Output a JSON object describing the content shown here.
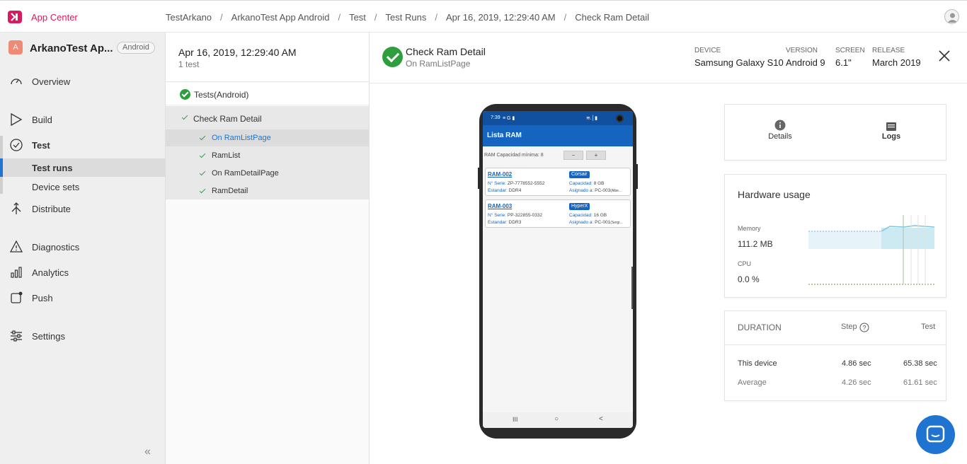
{
  "topbar": {
    "app_title": "App Center",
    "breadcrumbs": [
      "TestArkano",
      "ArkanoTest App Android",
      "Test",
      "Test Runs",
      "Apr 16, 2019, 12:29:40 AM",
      "Check Ram Detail"
    ],
    "separator": "/",
    "brand_color": "#d81b60"
  },
  "sidebar": {
    "app_badge": "A",
    "app_name": "ArkanoTest Ap...",
    "platform": "Android",
    "items": [
      {
        "label": "Overview",
        "icon": "gauge-icon"
      },
      {
        "label": "Build",
        "icon": "play-icon"
      },
      {
        "label": "Test",
        "icon": "check-circle-icon"
      },
      {
        "label": "Test runs"
      },
      {
        "label": "Device sets"
      },
      {
        "label": "Distribute",
        "icon": "distribute-icon"
      },
      {
        "label": "Diagnostics",
        "icon": "warning-icon"
      },
      {
        "label": "Analytics",
        "icon": "bar-chart-icon"
      },
      {
        "label": "Push",
        "icon": "push-icon"
      },
      {
        "label": "Settings",
        "icon": "sliders-icon"
      }
    ],
    "collapse_glyph": "«",
    "accent_color": "#1e74d0"
  },
  "runs": {
    "title": "Apr 16, 2019, 12:29:40 AM",
    "subtitle": "1 test",
    "tree": [
      {
        "label": "Tests(Android)"
      },
      {
        "label": "Check Ram Detail"
      },
      {
        "label": "On RamListPage"
      },
      {
        "label": "RamList"
      },
      {
        "label": "On RamDetailPage"
      },
      {
        "label": "RamDetail"
      }
    ]
  },
  "detail": {
    "title": "Check Ram Detail",
    "subtitle": "On RamListPage",
    "meta": [
      {
        "label": "DEVICE",
        "value": "Samsung Galaxy S10"
      },
      {
        "label": "VERSION",
        "value": "Android 9"
      },
      {
        "label": "SCREEN",
        "value": "6.1\""
      },
      {
        "label": "RELEASE",
        "value": "March 2019"
      }
    ],
    "status_color": "#2e9e3f"
  },
  "phone": {
    "status_time": "7:39",
    "status_extra": "≡ G ▮",
    "status_right": "≋.│▮",
    "appbar_title": "Lista RAM",
    "filter_label": "RAM Capacidad mínima: 8",
    "minus": "−",
    "plus": "+",
    "cards": [
      {
        "code": "RAM-002",
        "brand": "Corsair",
        "serie_k": "N° Serie:",
        "serie_v": "ZP-7778552-5552",
        "std_k": "Estandar:",
        "std_v": "DDR4",
        "cap_k": "Capacidad:",
        "cap_v": "8 GB",
        "asig_k": "Asignado a:",
        "asig_v": "PC-003",
        "asig_x": "(Albe..."
      },
      {
        "code": "RAM-003",
        "brand": "HyperX",
        "serie_k": "N° Serie:",
        "serie_v": "PP-322855-0332",
        "std_k": "Estandar:",
        "std_v": "DDR3",
        "cap_k": "Capacidad:",
        "cap_v": "16 GB",
        "asig_k": "Asignado a:",
        "asig_v": "PC-001",
        "asig_x": "(Sergi..."
      }
    ],
    "nav": [
      "III",
      "○",
      "<"
    ],
    "brand_color": "#1565c0"
  },
  "tabs": {
    "details": "Details",
    "logs": "Logs"
  },
  "hardware": {
    "title": "Hardware usage",
    "memory_label": "Memory",
    "memory_value": "111.2 MB",
    "cpu_label": "CPU",
    "cpu_value": "0.0 %",
    "memory_color": "#7fc4dc",
    "cpu_color": "#7a9a3a"
  },
  "duration": {
    "title": "DURATION",
    "col_step": "Step",
    "col_test": "Test",
    "rows": [
      {
        "label": "This device",
        "step": "4.86 sec",
        "test": "65.38 sec"
      },
      {
        "label": "Average",
        "step": "4.26 sec",
        "test": "61.61 sec"
      }
    ]
  },
  "chat": {
    "icon": "chat-icon"
  }
}
